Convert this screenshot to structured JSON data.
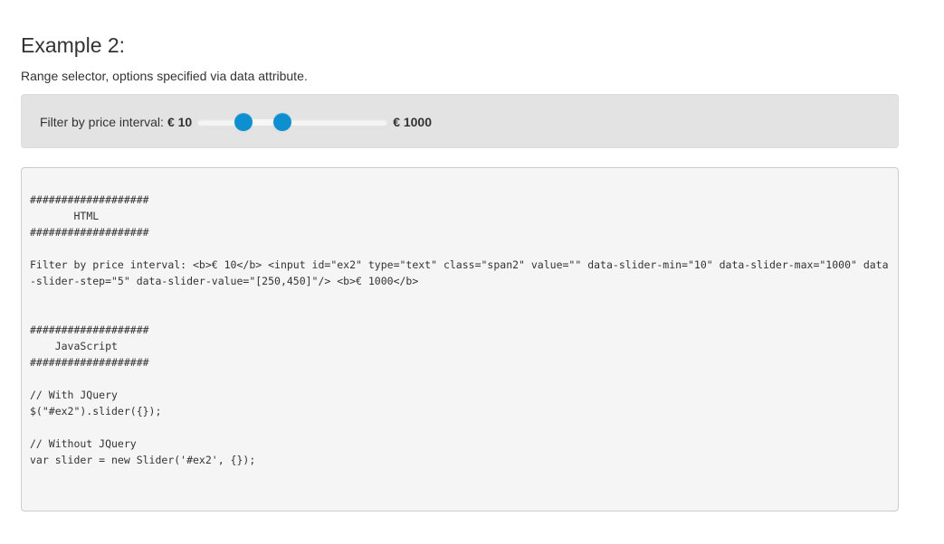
{
  "page": {
    "title": "Example 2:",
    "subtitle": "Range selector, options specified via data attribute."
  },
  "demo": {
    "filter_label": "Filter by price interval: ",
    "min_label": "€ 10",
    "max_label": "€ 1000",
    "slider": {
      "min": 10,
      "max": 1000,
      "values": [
        250,
        450
      ]
    }
  },
  "code": {
    "text": "###################\n       HTML\n###################\n\nFilter by price interval: <b>€ 10</b> <input id=\"ex2\" type=\"text\" class=\"span2\" value=\"\" data-slider-min=\"10\" data-slider-max=\"1000\" data-slider-step=\"5\" data-slider-value=\"[250,450]\"/> <b>€ 1000</b>\n\n\n###################\n    JavaScript\n###################\n\n// With JQuery\n$(\"#ex2\").slider({});\n\n// Without JQuery\nvar slider = new Slider('#ex2', {});"
  },
  "colors": {
    "handle": "#0e8fd0",
    "well_background": "#e3e3e3",
    "code_background": "#f5f5f5"
  }
}
